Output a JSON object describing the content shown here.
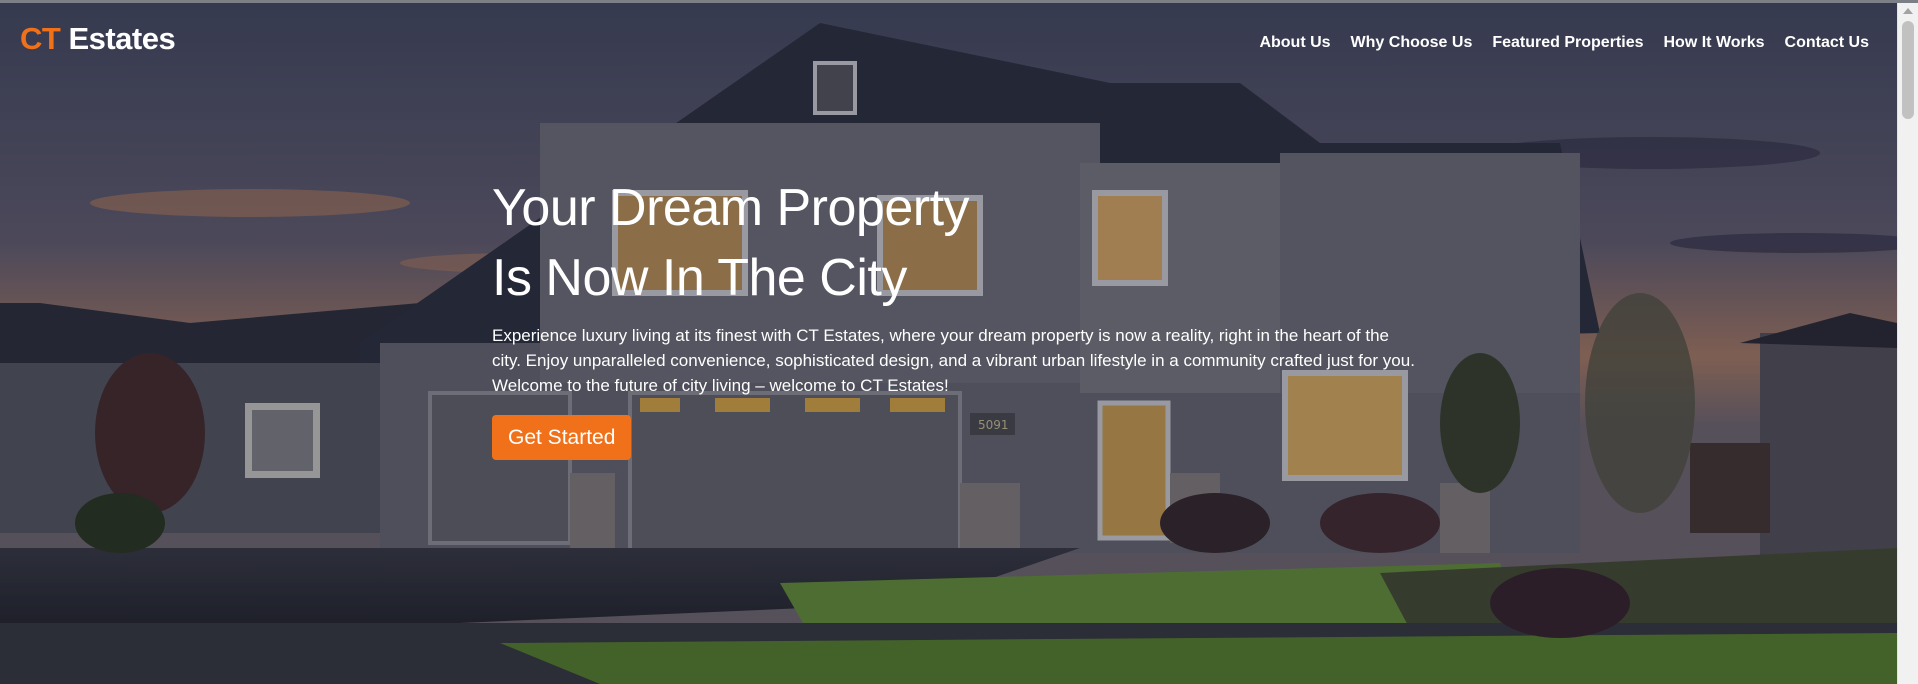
{
  "brand": {
    "accent": "CT",
    "name": " Estates"
  },
  "nav": [
    {
      "label": "About Us"
    },
    {
      "label": "Why Choose Us"
    },
    {
      "label": "Featured Properties"
    },
    {
      "label": "How It Works"
    },
    {
      "label": "Contact Us"
    }
  ],
  "hero": {
    "title_line1": "Your Dream Property",
    "title_line2": "Is Now In The City",
    "description": "Experience luxury living at its finest with CT Estates, where your dream property is now a reality, right in the heart of the city. Enjoy unparalleled convenience, sophisticated design, and a vibrant urban lifestyle in a community crafted just for you. Welcome to the future of city living – welcome to CT Estates!",
    "cta_label": "Get Started",
    "house_number": "5091"
  },
  "colors": {
    "accent": "#f0711a",
    "text": "#ffffff"
  }
}
